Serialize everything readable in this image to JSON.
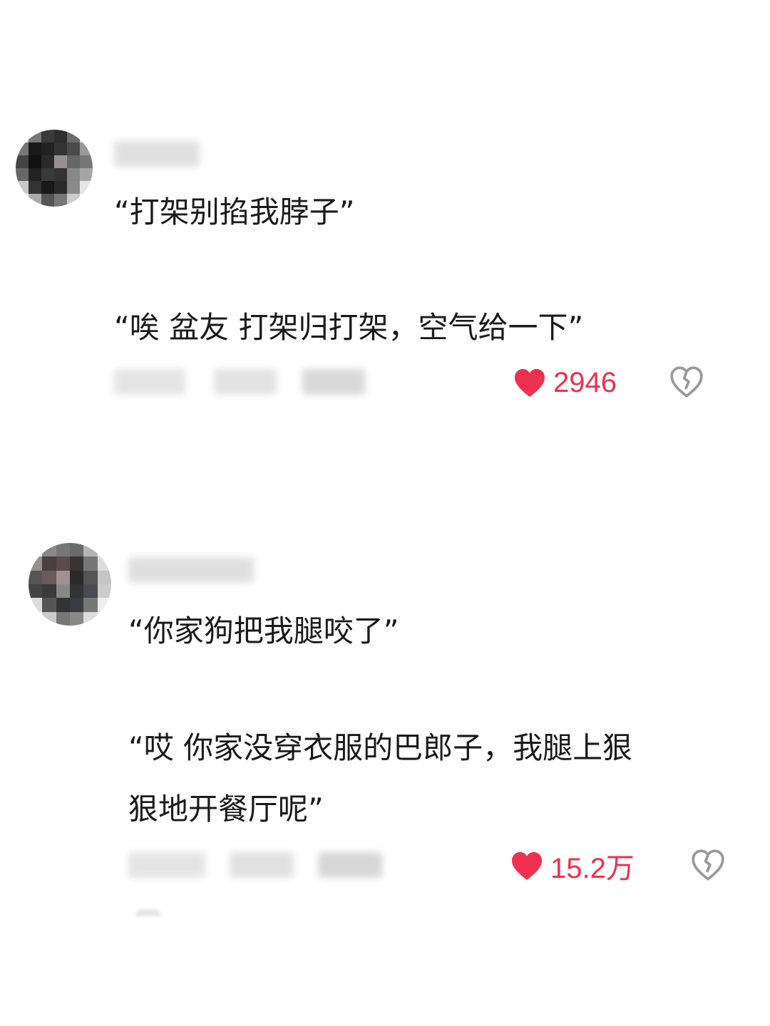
{
  "comments": [
    {
      "lines": [
        "“打架别掐我脖子”",
        "“唉 盆友 打架归打架，空气给一下”"
      ],
      "likes": "2946"
    },
    {
      "lines": [
        "“你家狗把我腿咬了”",
        "“哎 你家没穿衣服的巴郎子，我腿上狠",
        "狠地开餐厅呢”"
      ],
      "likes": "15.2万"
    }
  ],
  "colors": {
    "like": "#f0304f",
    "text": "#1a1a1a",
    "icon_gray": "#9a9a9a"
  },
  "icons": {
    "like": "heart-icon",
    "dislike": "broken-heart-icon"
  }
}
